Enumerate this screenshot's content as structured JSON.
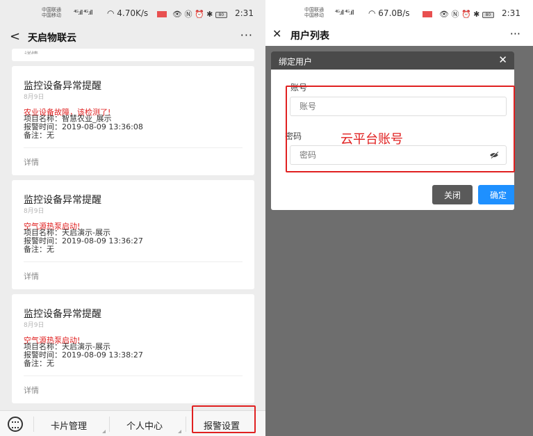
{
  "left": {
    "status": {
      "carrier_1": "中国联通",
      "carrier_2": "中国移动",
      "signal": "⁴ᴳ.ıll ⁴ᴳ.ıll",
      "speed": "4.70K/s",
      "time": "2:31",
      "battery": "80"
    },
    "header": {
      "back": "<",
      "title": "天启物联云",
      "more": "···"
    },
    "partial_detail": "详情",
    "cards": [
      {
        "title": "监控设备异常提醒",
        "date": "8月9日",
        "alert": "农业设备故障，该检测了!",
        "project": "项目名称：智慧农业_展示",
        "alarm_time": "报警时间：2019-08-09 13:36:08",
        "note": "备注：无",
        "detail": "详情"
      },
      {
        "title": "监控设备异常提醒",
        "date": "8月9日",
        "alert": "空气源热泵启动!",
        "project": "项目名称：天启演示-展示",
        "alarm_time": "报警时间：2019-08-09 13:36:27",
        "note": "备注：无",
        "detail": "详情"
      },
      {
        "title": "监控设备异常提醒",
        "date": "8月9日",
        "alert": "空气源热泵启动!",
        "project": "项目名称：天启演示-展示",
        "alarm_time": "报警时间：2019-08-09 13:38:27",
        "note": "备注：无",
        "detail": "详情"
      }
    ],
    "tabs": {
      "card_manage": "卡片管理",
      "personal_center": "个人中心",
      "alarm_settings": "报警设置"
    },
    "accent_red": "#e02020"
  },
  "right": {
    "status": {
      "carrier_1": "中国联通",
      "carrier_2": "中国移动",
      "signal": "⁴ᴳ.ıll ⁴ᴳ.ıll",
      "speed": "67.0B/s",
      "time": "2:31",
      "battery": "80"
    },
    "header": {
      "close": "✕",
      "title": "用户列表",
      "more": "···"
    },
    "modal": {
      "title": "绑定用户",
      "close": "✕",
      "account_label": "账号",
      "account_placeholder": "账号",
      "password_label": "密码",
      "password_placeholder": "密码",
      "annotation": "云平台账号",
      "btn_close": "关闭",
      "btn_ok": "确定"
    },
    "button_blue": "#1e90ff"
  }
}
